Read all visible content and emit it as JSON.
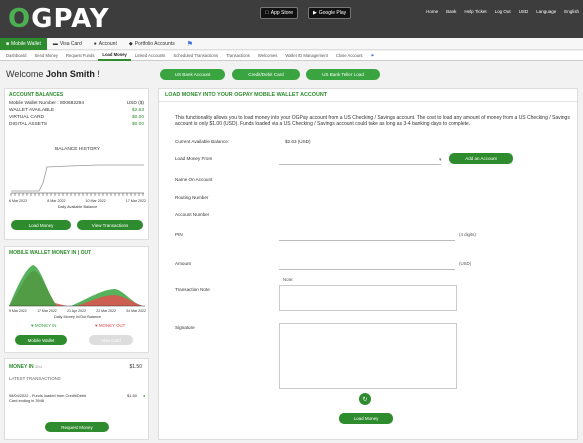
{
  "header": {
    "logo": "OGPAY",
    "app_store": "App Store",
    "google_play": "Google Play",
    "nav": [
      "Home",
      "Bank",
      "Help Ticket",
      "Log Out",
      "USD",
      "Language",
      "English"
    ]
  },
  "greennav": {
    "items": [
      {
        "label": "Mobile Wallet",
        "active": true
      },
      {
        "label": "Visa Card",
        "active": false
      },
      {
        "label": "Account",
        "active": false
      },
      {
        "label": "Portfolio Accounts",
        "active": false
      }
    ]
  },
  "subnav": {
    "items": [
      "Dashboard",
      "Send Money",
      "Request Funds",
      "Load Money",
      "Linked Accounts",
      "Scheduled Transactions",
      "Transactions",
      "Welcomes",
      "Wallet ID Management",
      "Close Account"
    ],
    "active": "Load Money"
  },
  "welcome": {
    "prefix": "Welcome ",
    "name": "John Smith",
    "suffix": " !"
  },
  "load_tabs": [
    "US Bank Account",
    "Credit/Debit Card",
    "US Bank Teller Load"
  ],
  "account_balances": {
    "title": "ACCOUNT BALANCES",
    "rows": [
      {
        "label": "Mobile Wallet Number : 800682294",
        "value": "USD ($)"
      },
      {
        "label": "WALLET AVAILABLE",
        "value": "$2.63"
      },
      {
        "label": "VIRTUAL CARD",
        "value": "$0.00"
      },
      {
        "label": "DIGITAL ASSETS",
        "value": "$0.00"
      }
    ],
    "chart_title": "BALANCE HISTORY",
    "chart_caption": "Daily Available Balance",
    "ticks": [
      "6 Mar 2022",
      "8 Mar 2022",
      "10 Mar 2022",
      "17 Mar 2022"
    ],
    "btn_load": "Load Money",
    "btn_transactions": "View Transactions"
  },
  "wallet_in_out": {
    "title": "MOBILE WALLET MONEY IN | OUT",
    "ticks": [
      "9 Mar 2022",
      "17 Mar 2022",
      "21 Apr 2022",
      "22 Mar 2022",
      "04 Mar 2022"
    ],
    "caption": "Daily Money In/Out Balance",
    "legend_in": "MONEY IN",
    "legend_out": "MONEY OUT",
    "btn_mobile": "Mobile Wallet",
    "btn_visa": "Visa Card",
    "colors": {
      "in": "#3aa540",
      "out": "#e05050"
    }
  },
  "money_in": {
    "title": "MONEY IN",
    "period": "30d",
    "amount": "$1.50",
    "latest_label": "LATEST TRANSACTIONS",
    "tx_date": "08/04/2022",
    "tx_desc": "Funds loaded from Credit/Debit Card ending in 3946",
    "tx_amount": "$1.50",
    "btn_request": "Request Money"
  },
  "main": {
    "title": "LOAD MONEY INTO YOUR OGPAY MOBILE WALLET ACCOUNT",
    "intro": "This functionality allows you to load money into your OGPay account from a US Checking / Savings account. The cost to load any amount of money from a US Checking / Savings account is only $1.00 (USD). Funds loaded via a US Checking / Savings account could take as long as 3-4 banking days to complete.",
    "current_balance_label": "Current Available Balance:",
    "current_balance_value": "$2.63 (USD)",
    "load_from_label": "Load Money From",
    "add_account_btn": "Add an Account",
    "name_label": "Name On Account",
    "routing_label": "Routing Number",
    "account_label": "Account Number",
    "pin_label": "PIN",
    "pin_hint": "(4 digits)",
    "amount_label": "Amount",
    "amount_hint": "(USD)",
    "note_label": "Note:",
    "transaction_note_label": "Transaction Note",
    "signature_label": "Signature",
    "submit_btn": "Load Money"
  }
}
